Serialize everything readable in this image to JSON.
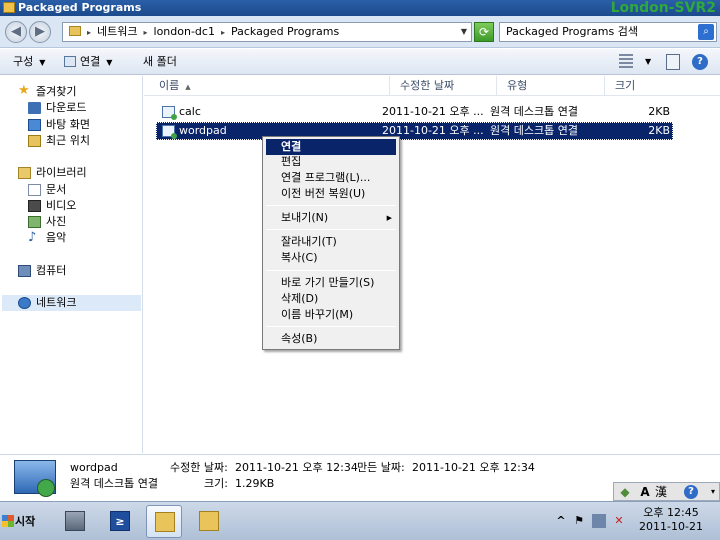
{
  "window": {
    "title": "Packaged Programs",
    "hostname_overlay": "London-SVR2"
  },
  "nav_buttons": {
    "back": "◀",
    "forward": "▶"
  },
  "address": {
    "crumbs": [
      "네트워크",
      "london-dc1",
      "Packaged Programs"
    ],
    "separator": "▸",
    "dropdown": "▼",
    "refresh": "⟳"
  },
  "search": {
    "placeholder": "Packaged Programs 검색",
    "icon": "search-icon"
  },
  "toolbar": {
    "organize": "구성",
    "connect": "연결",
    "new_folder": "새 폴더",
    "dropdown_arrow": "▼",
    "help": "?"
  },
  "nav_pane": {
    "favorites": "즐겨찾기",
    "downloads": "다운로드",
    "desktop": "바탕 화면",
    "recent": "최근 위치",
    "libraries": "라이브러리",
    "documents": "문서",
    "videos": "비디오",
    "pictures": "사진",
    "music": "음악",
    "computer": "컴퓨터",
    "network": "네트워크",
    "favorites_icon": "★",
    "music_icon": "♪"
  },
  "columns": {
    "name": "이름",
    "modified": "수정한 날짜",
    "type": "유형",
    "size": "크기",
    "sort_indicator": "▲"
  },
  "files": [
    {
      "name": "calc",
      "modified": "2011-10-21 오후 ...",
      "type": "원격 데스크톱 연결",
      "size": "2KB"
    },
    {
      "name": "wordpad",
      "modified": "2011-10-21 오후 ...",
      "type": "원격 데스크톱 연결",
      "size": "2KB"
    }
  ],
  "context_menu": {
    "connect": "연결",
    "edit": "편집",
    "open_with": "연결 프로그램(L)...",
    "restore": "이전 버전 복원(U)",
    "send_to": "보내기(N)",
    "submenu_arrow": "▶",
    "cut": "잘라내기(T)",
    "copy": "복사(C)",
    "create_shortcut": "바로 가기 만들기(S)",
    "delete": "삭제(D)",
    "rename": "이름 바꾸기(M)",
    "properties": "속성(B)"
  },
  "details": {
    "name": "wordpad",
    "type": "원격 데스크톱 연결",
    "modified_label": "수정한 날짜:",
    "modified": "2011-10-21 오후 12:34",
    "created_label": "만든 날짜:",
    "created": "2011-10-21 오후 12:34",
    "size_label": "크기:",
    "size": "1.29KB"
  },
  "langbar": {
    "mode_a": "A",
    "hanja": "漢",
    "help": "?"
  },
  "taskbar": {
    "start": "시작",
    "powershell": "≥"
  },
  "tray": {
    "up": "^",
    "time": "오후 12:45",
    "date": "2011-10-21"
  }
}
